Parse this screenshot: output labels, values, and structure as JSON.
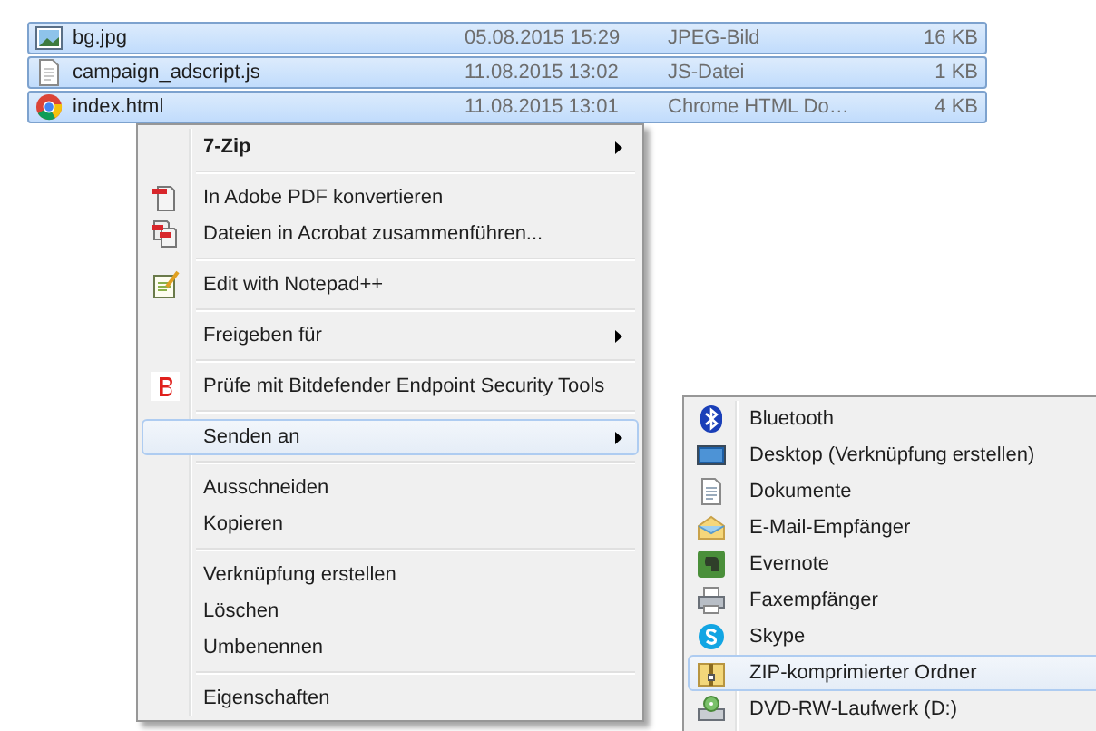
{
  "files": [
    {
      "name": "bg.jpg",
      "date": "05.08.2015 15:29",
      "type": "JPEG-Bild",
      "size": "16 KB",
      "selected": true
    },
    {
      "name": "campaign_adscript.js",
      "date": "11.08.2015 13:02",
      "type": "JS-Datei",
      "size": "1 KB",
      "selected": true
    },
    {
      "name": "index.html",
      "date": "11.08.2015 13:01",
      "type": "Chrome HTML Do…",
      "size": "4 KB",
      "selected": true
    }
  ],
  "context_menu": {
    "groups": [
      [
        {
          "label": "7-Zip",
          "bold": true,
          "submenu": true,
          "highlighted": false
        }
      ],
      [
        {
          "label": "In Adobe PDF konvertieren",
          "bold": false,
          "submenu": false,
          "highlighted": false
        },
        {
          "label": "Dateien in Acrobat zusammenführen...",
          "bold": false,
          "submenu": false,
          "highlighted": false
        }
      ],
      [
        {
          "label": "Edit with Notepad++",
          "bold": false,
          "submenu": false,
          "highlighted": false
        }
      ],
      [
        {
          "label": "Freigeben für",
          "bold": false,
          "submenu": true,
          "highlighted": false
        }
      ],
      [
        {
          "label": "Prüfe mit Bitdefender Endpoint Security Tools",
          "bold": false,
          "submenu": false,
          "highlighted": false
        }
      ],
      [
        {
          "label": "Senden an",
          "bold": false,
          "submenu": true,
          "highlighted": true
        }
      ],
      [
        {
          "label": "Ausschneiden",
          "bold": false,
          "submenu": false,
          "highlighted": false
        },
        {
          "label": "Kopieren",
          "bold": false,
          "submenu": false,
          "highlighted": false
        }
      ],
      [
        {
          "label": "Verknüpfung erstellen",
          "bold": false,
          "submenu": false,
          "highlighted": false
        },
        {
          "label": "Löschen",
          "bold": false,
          "submenu": false,
          "highlighted": false
        },
        {
          "label": "Umbenennen",
          "bold": false,
          "submenu": false,
          "highlighted": false
        }
      ],
      [
        {
          "label": "Eigenschaften",
          "bold": false,
          "submenu": false,
          "highlighted": false
        }
      ]
    ]
  },
  "send_to_menu": {
    "items": [
      {
        "label": "Bluetooth",
        "highlighted": false
      },
      {
        "label": "Desktop (Verknüpfung erstellen)",
        "highlighted": false
      },
      {
        "label": "Dokumente",
        "highlighted": false
      },
      {
        "label": "E-Mail-Empfänger",
        "highlighted": false
      },
      {
        "label": "Evernote",
        "highlighted": false
      },
      {
        "label": "Faxempfänger",
        "highlighted": false
      },
      {
        "label": "Skype",
        "highlighted": false
      },
      {
        "label": "ZIP-komprimierter Ordner",
        "highlighted": true
      },
      {
        "label": "DVD-RW-Laufwerk (D:)",
        "highlighted": false
      }
    ]
  }
}
